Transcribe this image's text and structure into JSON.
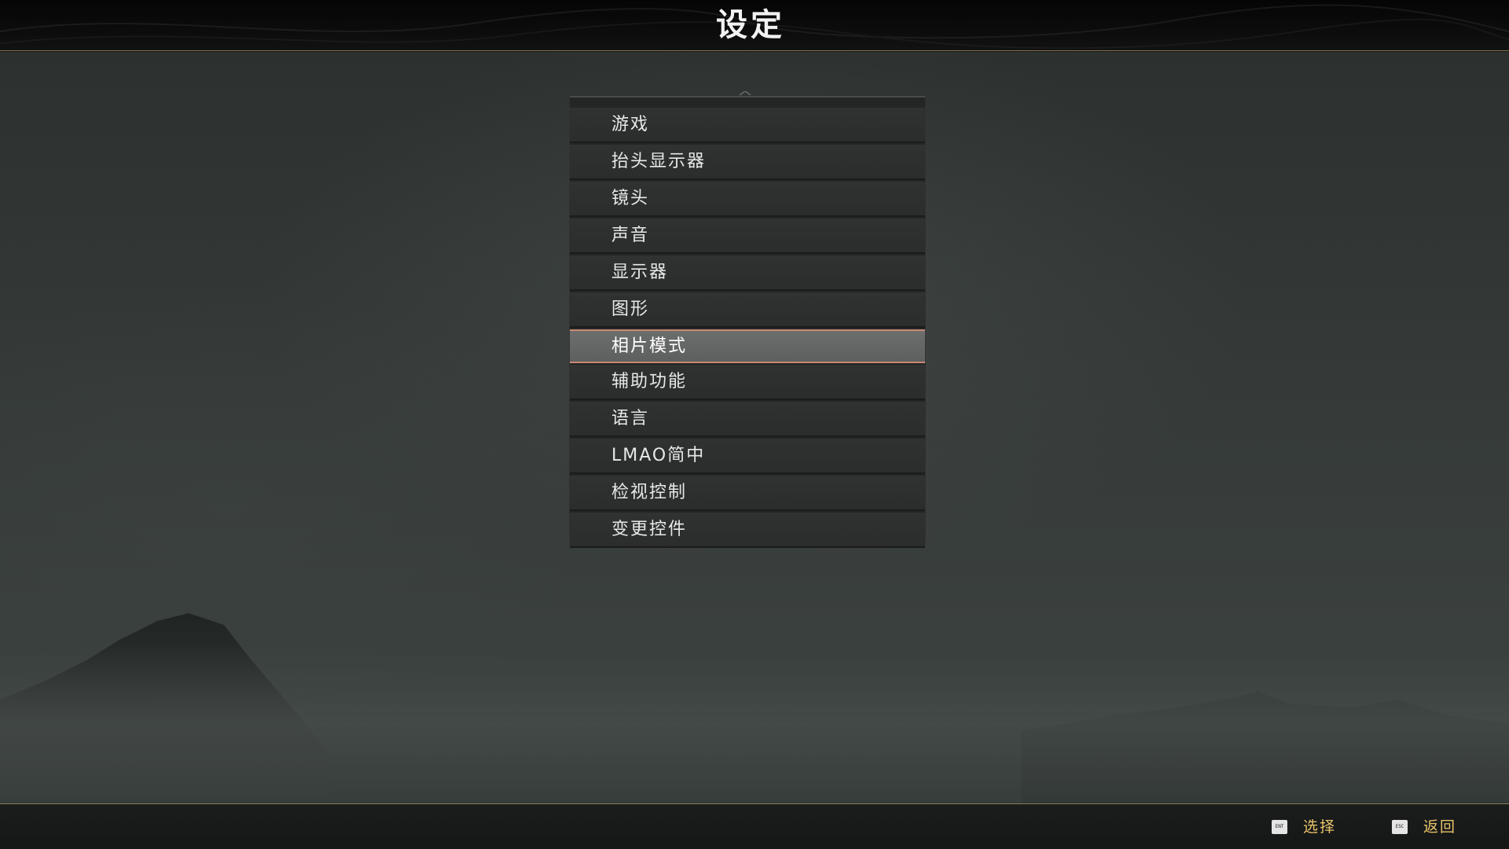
{
  "header": {
    "title": "设定"
  },
  "menu": {
    "items": [
      {
        "label": "游戏"
      },
      {
        "label": "抬头显示器"
      },
      {
        "label": "镜头"
      },
      {
        "label": "声音"
      },
      {
        "label": "显示器"
      },
      {
        "label": "图形"
      },
      {
        "label": "相片模式",
        "selected": true
      },
      {
        "label": "辅助功能"
      },
      {
        "label": "语言"
      },
      {
        "label": "LMAO简中"
      },
      {
        "label": "检视控制"
      },
      {
        "label": "变更控件"
      }
    ]
  },
  "footer": {
    "select": {
      "key_icon": "ENT",
      "label": "选择"
    },
    "back": {
      "key_icon": "ESC",
      "label": "返回"
    }
  },
  "colors": {
    "accent": "#e8c36a",
    "selection_border": "#c98973",
    "header_rule": "#8a7a55"
  }
}
